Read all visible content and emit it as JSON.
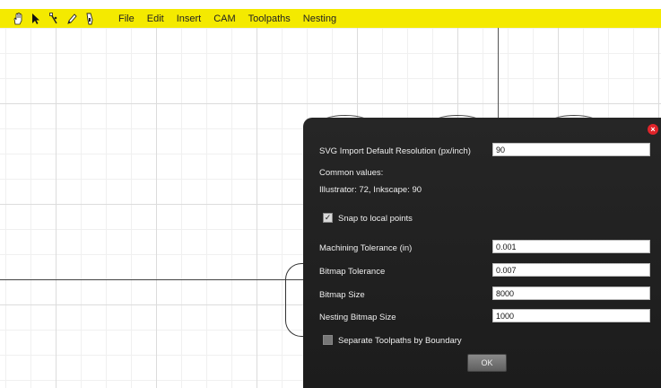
{
  "toolbar": {
    "tools": [
      "hand-icon",
      "pointer-icon",
      "node-edit-icon",
      "pencil-icon",
      "knife-icon"
    ],
    "menus": [
      "File",
      "Edit",
      "Insert",
      "CAM",
      "Toolpaths",
      "Nesting"
    ]
  },
  "dialog": {
    "svg_resolution_label": "SVG Import Default Resolution (px/inch)",
    "svg_resolution_value": "90",
    "common_values_label": "Common values:",
    "common_values_text": "Illustrator: 72, Inkscape: 90",
    "snap_label": "Snap to local points",
    "snap_checked": true,
    "machining_tolerance_label": "Machining Tolerance (in)",
    "machining_tolerance_value": "0.001",
    "bitmap_tolerance_label": "Bitmap Tolerance",
    "bitmap_tolerance_value": "0.007",
    "bitmap_size_label": "Bitmap Size",
    "bitmap_size_value": "8000",
    "nesting_bitmap_size_label": "Nesting Bitmap Size",
    "nesting_bitmap_size_value": "1000",
    "separate_label": "Separate Toolpaths by Boundary",
    "separate_checked": false,
    "ok_label": "OK",
    "close_glyph": "×"
  },
  "colors": {
    "toolbar_bg": "#f4ea00",
    "dialog_bg": "#222222",
    "close_red": "#e0242a"
  }
}
